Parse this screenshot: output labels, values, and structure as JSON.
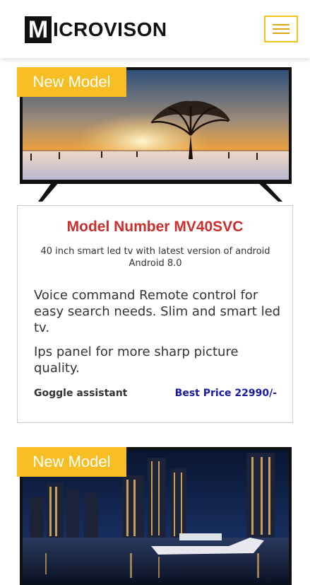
{
  "header": {
    "logo_letter": "M",
    "logo_text": "ICROVISON",
    "menu_icon": "hamburger-menu-icon"
  },
  "products": [
    {
      "badge": "New Model",
      "image": "tv-sunset-tree-image",
      "title": "Model Number MV40SVC",
      "subtitle": "40 inch smart led tv with latest version of android Android 8.0",
      "description1": "Voice command Remote control for easy search needs. Slim and smart led tv.",
      "description2": "Ips panel for more sharp picture quality.",
      "feature": "Goggle assistant",
      "price": "Best Price 22990/-"
    },
    {
      "badge": "New Model",
      "image": "tv-city-night-image"
    }
  ],
  "colors": {
    "badge": "#f6be22",
    "title": "#cc2d2d",
    "price": "#1919a3",
    "menu_border": "#f3c21b"
  }
}
